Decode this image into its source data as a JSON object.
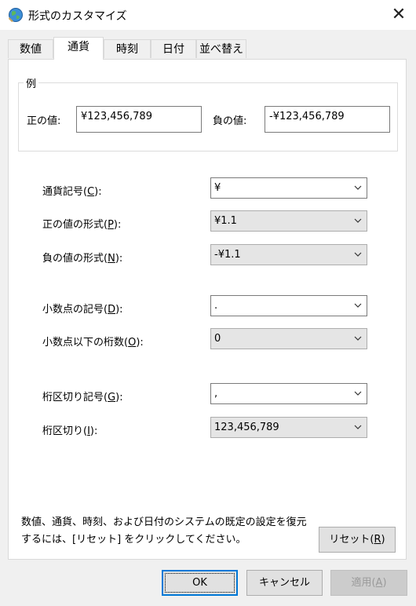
{
  "window": {
    "title": "形式のカスタマイズ",
    "close_glyph": "✕"
  },
  "tabs": [
    {
      "label": "数値"
    },
    {
      "label": "通貨"
    },
    {
      "label": "時刻"
    },
    {
      "label": "日付"
    },
    {
      "label": "並べ替え"
    }
  ],
  "active_tab": "通貨",
  "example": {
    "group_label": "例",
    "positive_label": "正の値:",
    "positive_value": "¥123,456,789",
    "negative_label": "負の値:",
    "negative_value": "-¥123,456,789"
  },
  "settings": {
    "currency_symbol": {
      "label": "通貨記号(",
      "key": "C",
      "label_end": "):",
      "value": "¥"
    },
    "positive_format": {
      "label": "正の値の形式(",
      "key": "P",
      "label_end": "):",
      "value": "¥1.1"
    },
    "negative_format": {
      "label": "負の値の形式(",
      "key": "N",
      "label_end": "):",
      "value": "-¥1.1"
    },
    "decimal_symbol": {
      "label": "小数点の記号(",
      "key": "D",
      "label_end": "):",
      "value": "."
    },
    "decimal_digits": {
      "label": "小数点以下の桁数(",
      "key": "O",
      "label_end": "):",
      "value": "0"
    },
    "grouping_symbol": {
      "label": "桁区切り記号(",
      "key": "G",
      "label_end": "):",
      "value": ","
    },
    "grouping": {
      "label": "桁区切り(",
      "key": "I",
      "label_end": "):",
      "value": "123,456,789"
    }
  },
  "footer": {
    "reset_info_line1": "数値、通貨、時刻、および日付のシステムの既定の設定を復元",
    "reset_info_line2": "するには、[リセット] をクリックしてください。",
    "reset_label": "リセット(",
    "reset_key": "R",
    "reset_end": ")"
  },
  "buttons": {
    "ok": "OK",
    "cancel": "キャンセル",
    "apply_label": "適用(",
    "apply_key": "A",
    "apply_end": ")"
  },
  "colors": {
    "focus_blue": "#0078d7",
    "panel": "#ffffff",
    "background": "#f0f0f0"
  }
}
